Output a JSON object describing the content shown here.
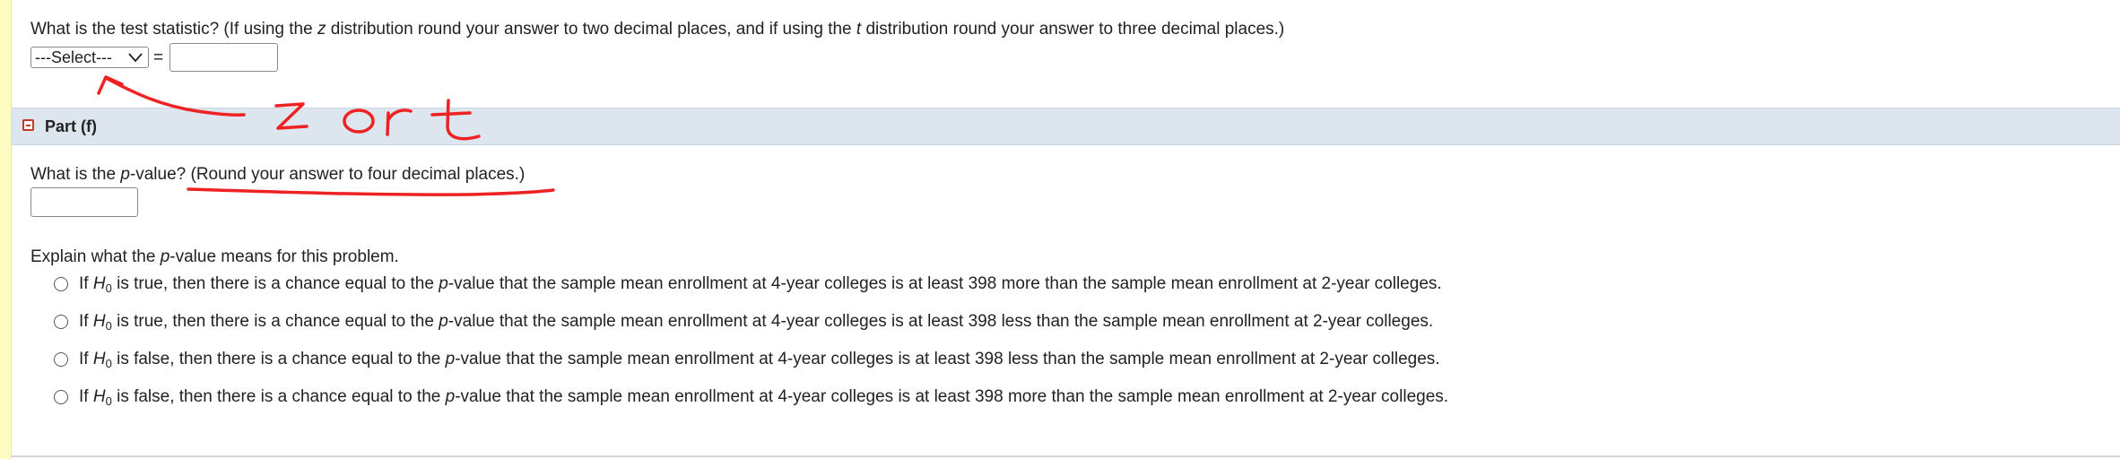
{
  "test_stat": {
    "question_pre": "What is the test statistic? (If using the ",
    "z_symbol": "z",
    "question_mid": " distribution round your answer to two decimal places, and if using the ",
    "t_symbol": "t",
    "question_post": " distribution round your answer to three decimal places.)",
    "select_value": "---Select---",
    "equals": "=",
    "answer_value": ""
  },
  "part_f": {
    "toggle_icon": "collapse-minus-icon",
    "title": "Part (f)",
    "pvalue_question_pre": "What is the ",
    "p_symbol": "p",
    "pvalue_question_post": "-value? (Round your answer to four decimal places.)",
    "pvalue_answer": "",
    "explain_pre": "Explain what the ",
    "explain_post": "-value means for this problem.",
    "options": [
      {
        "lead": "If ",
        "h": "H",
        "sub": "0",
        "mid": " is true, then there is a chance equal to the ",
        "p": "p",
        "tail": "-value that the sample mean enrollment at 4-year colleges is at least 398 more than the sample mean enrollment at 2-year colleges."
      },
      {
        "lead": "If ",
        "h": "H",
        "sub": "0",
        "mid": " is true, then there is a chance equal to the ",
        "p": "p",
        "tail": "-value that the sample mean enrollment at 4-year colleges is at least 398 less than the sample mean enrollment at 2-year colleges."
      },
      {
        "lead": "If ",
        "h": "H",
        "sub": "0",
        "mid": " is false, then there is a chance equal to the ",
        "p": "p",
        "tail": "-value that the sample mean enrollment at 4-year colleges is at least 398 less than the sample mean enrollment at 2-year colleges."
      },
      {
        "lead": "If ",
        "h": "H",
        "sub": "0",
        "mid": " is false, then there is a chance equal to the ",
        "p": "p",
        "tail": "-value that the sample mean enrollment at 4-year colleges is at least 398 more than the sample mean enrollment at 2-year colleges."
      }
    ]
  },
  "annotations": {
    "handwritten_note": "z or t",
    "ink_color": "#ee2222"
  },
  "colors": {
    "part_bar": "#dde6ee",
    "left_rule": "#fdfdc2",
    "toggle": "#c0392b"
  }
}
